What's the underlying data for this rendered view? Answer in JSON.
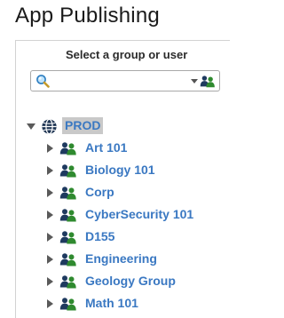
{
  "page": {
    "title": "App Publishing"
  },
  "selector": {
    "label": "Select a group or user",
    "search_value": "",
    "search_placeholder": ""
  },
  "tree": {
    "root": {
      "label": "PROD",
      "icon": "globe-icon",
      "expanded": true,
      "selected": true
    },
    "children": [
      {
        "label": "Art 101",
        "icon": "user-group-icon"
      },
      {
        "label": "Biology 101",
        "icon": "user-group-icon"
      },
      {
        "label": "Corp",
        "icon": "user-group-icon"
      },
      {
        "label": "CyberSecurity 101",
        "icon": "user-group-icon"
      },
      {
        "label": "D155",
        "icon": "user-group-icon"
      },
      {
        "label": "Engineering",
        "icon": "user-group-icon"
      },
      {
        "label": "Geology Group",
        "icon": "user-group-icon"
      },
      {
        "label": "Math 101",
        "icon": "user-group-icon"
      }
    ]
  },
  "colors": {
    "link_blue": "#3a78c2",
    "selection_gray": "#c9c9c9",
    "user_green": "#2f8a2f",
    "user_navy": "#1e3a5f"
  }
}
